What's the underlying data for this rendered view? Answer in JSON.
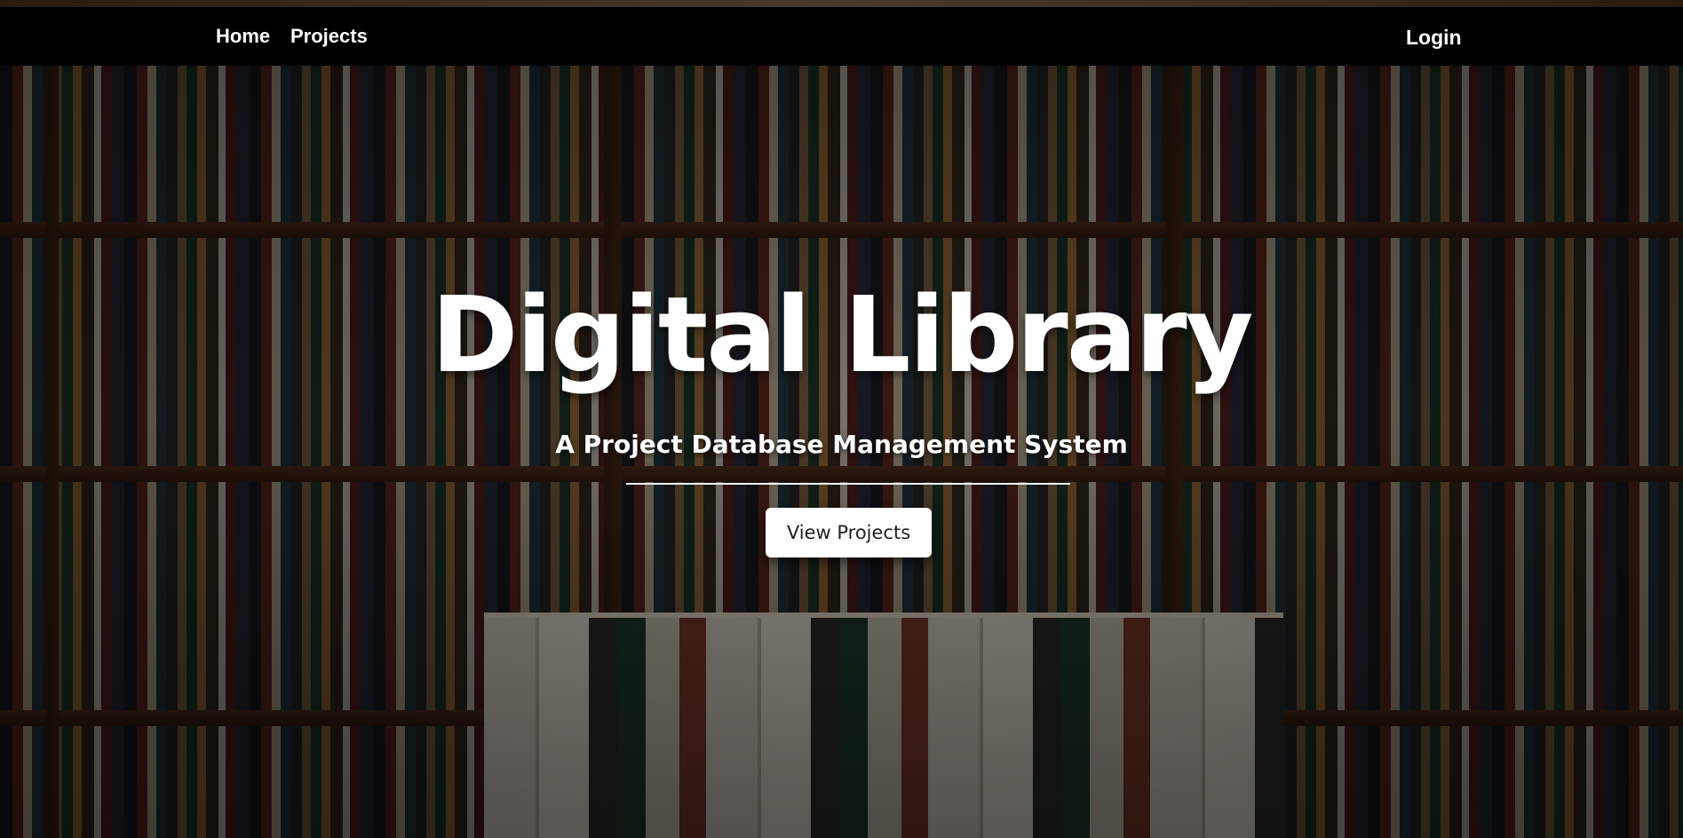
{
  "navbar": {
    "home_label": "Home",
    "projects_label": "Projects",
    "login_label": "Login"
  },
  "hero": {
    "title": "Digital Library",
    "subtitle": "A Project Database Management System",
    "cta_label": "View Projects"
  },
  "colors": {
    "navbar_background": "#000000",
    "text_primary": "#ffffff",
    "button_background": "#ffffff",
    "button_text": "#222222"
  }
}
